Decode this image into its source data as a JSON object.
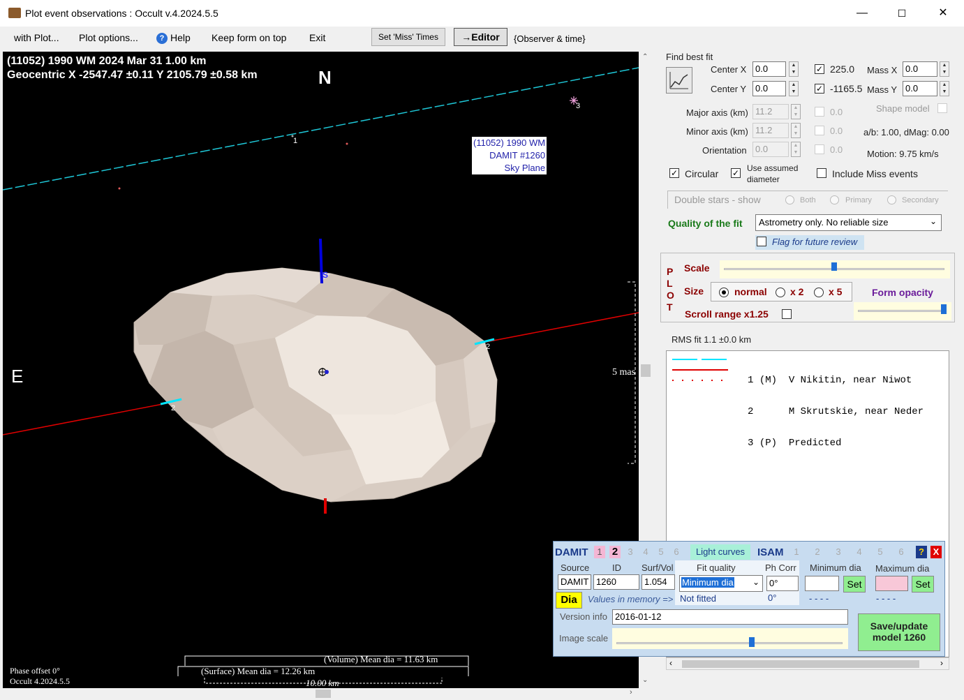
{
  "window": {
    "title": "Plot event observations : Occult v.4.2024.5.5"
  },
  "menu": {
    "with_plot": "with Plot...",
    "plot_options": "Plot options...",
    "help": "Help",
    "keep_on_top": "Keep form on top",
    "exit": "Exit",
    "set_miss": "Set 'Miss' Times",
    "editor": "→Editor",
    "observer_time": "{Observer & time}"
  },
  "plot": {
    "header1": "(11052) 1990 WM  2024 Mar 31   1.00 km",
    "header2": "Geocentric  X  -2547.47 ±0.11  Y 2105.79 ±0.58 km",
    "north": "N",
    "east": "E",
    "south_marker": "S",
    "label_box": [
      "(11052) 1990 WM",
      "DAMIT #1260",
      "Sky Plane"
    ],
    "chord1": "1",
    "chord2a": "2",
    "chord2b": "2",
    "star3": "3",
    "mas_label": "5 mas",
    "volume_dia": "(Volume) Mean dia = 11.63 km",
    "surface_dia": "(Surface) Mean dia = 12.26 km",
    "scale_km": "10.00 km",
    "phase_offset": "Phase offset 0°",
    "version": "Occult 4.2024.5.5"
  },
  "fit": {
    "find_best_fit": "Find best fit",
    "center_x_label": "Center X",
    "center_x": "0.0",
    "center_y_label": "Center Y",
    "center_y": "0.0",
    "x_value": "225.0",
    "y_value": "-1165.5",
    "mass_x_label": "Mass X",
    "mass_x": "0.0",
    "mass_y_label": "Mass Y",
    "mass_y": "0.0",
    "major_label": "Major axis (km)",
    "major": "11.2",
    "minor_label": "Minor axis (km)",
    "minor": "11.2",
    "orient_label": "Orientation",
    "orient": "0.0",
    "major_r": "0.0",
    "minor_r": "0.0",
    "orient_r": "0.0",
    "shape_model": "Shape model",
    "ab": "a/b: 1.00, dMag: 0.00",
    "motion": "Motion: 9.75 km/s",
    "circular": "Circular",
    "use_assumed": "Use assumed",
    "diameter": "diameter",
    "include_miss": "Include Miss events",
    "double_stars": "Double stars - show",
    "both": "Both",
    "primary": "Primary",
    "secondary": "Secondary",
    "quality_label": "Quality of the fit",
    "quality_value": "Astrometry only. No reliable size",
    "flag_review": "Flag for future review"
  },
  "plotpanel": {
    "letters": [
      "P",
      "L",
      "O",
      "T"
    ],
    "scale": "Scale",
    "size": "Size",
    "normal": "normal",
    "x2": "x 2",
    "x5": "x 5",
    "form_opacity": "Form opacity",
    "scroll_range": "Scroll range x1.25",
    "scale_value": 0.5,
    "opacity_value": 0.98
  },
  "rms": "RMS fit  1.1 ±0.0 km",
  "legend": [
    {
      "num": "1",
      "tag": "(M)",
      "name": "V Nikitin, near Niwot",
      "color": "#00e5ff"
    },
    {
      "num": "2",
      "tag": "",
      "name": "M Skrutskie, near Neder",
      "color": "#e00000"
    },
    {
      "num": "3",
      "tag": "(P)",
      "name": "Predicted",
      "color": "#e00000"
    }
  ],
  "damit": {
    "damit": "DAMIT",
    "tabs_damit": [
      "1",
      "2",
      "3",
      "4",
      "5",
      "6"
    ],
    "light_curves": "Light curves",
    "isam": "ISAM",
    "tabs_isam": [
      "1",
      "2",
      "3",
      "4",
      "5",
      "6"
    ],
    "help": "?",
    "close": "X",
    "source_label": "Source",
    "id_label": "ID",
    "surfvol_label": "Surf/Vol",
    "source": "DAMIT",
    "id": "1260",
    "surfvol": "1.054",
    "fit_quality_label": "Fit quality",
    "fit_quality": "Minimum dia",
    "ph_corr_label": "Ph Corr",
    "ph_corr": "0°",
    "min_dia_label": "Minimum dia",
    "max_dia_label": "Maximum dia",
    "set": "Set",
    "dia_btn": "Dia",
    "values_in_memory": "Values in memory =>",
    "not_fitted": "Not fitted",
    "ph_mem": "0°",
    "min_mem": "- - - -",
    "max_mem": "- - - -",
    "version_label": "Version info",
    "version": "2016-01-12",
    "image_scale_label": "Image scale",
    "image_scale_value": 0.6,
    "save1": "Save/update",
    "save2": "model  1260"
  }
}
